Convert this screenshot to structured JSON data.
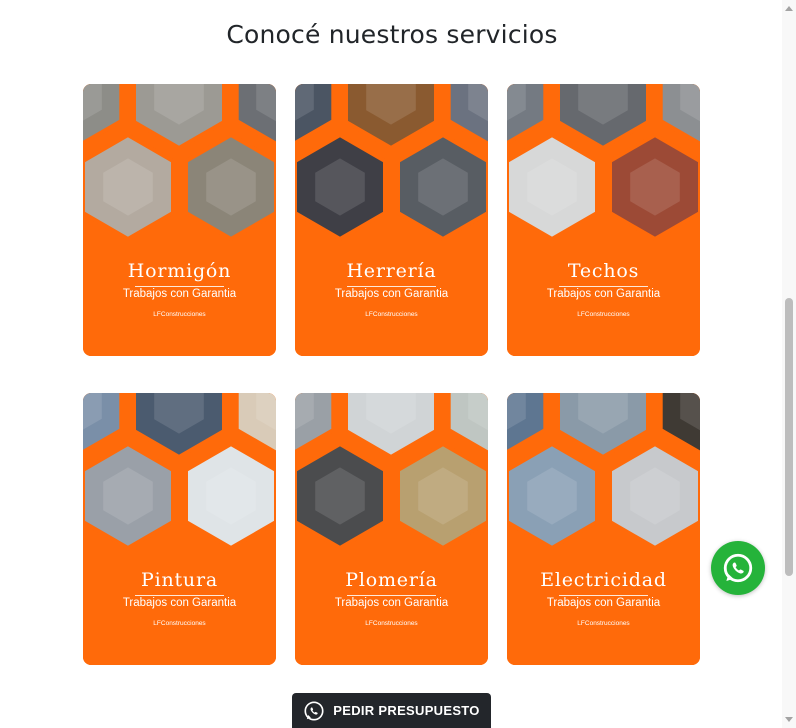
{
  "section": {
    "title": "Conocé nuestros servicios"
  },
  "services": [
    {
      "title": "Hormigón",
      "subtitle": "Trabajos con Garantia",
      "brand": "LFConstrucciones",
      "photos": [
        "#8d8d88",
        "#9c9a94",
        "#6c6f74",
        "#b3aaa0",
        "#8b8578"
      ]
    },
    {
      "title": "Herrería",
      "subtitle": "Trabajos con Garantia",
      "brand": "LFConstrucciones",
      "photos": [
        "#4b5563",
        "#8a5a30",
        "#6b7280",
        "#3f3f46",
        "#585d63"
      ]
    },
    {
      "title": "Techos",
      "subtitle": "Trabajos con Garantia",
      "brand": "LFConstrucciones",
      "photos": [
        "#747a82",
        "#66696e",
        "#8c8f92",
        "#d7d8d8",
        "#9c4a36"
      ]
    },
    {
      "title": "Pintura",
      "subtitle": "Trabajos con Garantia",
      "brand": "LFConstrucciones",
      "photos": [
        "#7a8fa8",
        "#4b5b6f",
        "#d9cbb8",
        "#9aa0a8",
        "#dfe4e7"
      ]
    },
    {
      "title": "Plomería",
      "subtitle": "Trabajos con Garantia",
      "brand": "LFConstrucciones",
      "photos": [
        "#9aa0a6",
        "#d0d4d6",
        "#bfc6c2",
        "#4b4c4e",
        "#b8a070"
      ]
    },
    {
      "title": "Electricidad",
      "subtitle": "Trabajos con Garantia",
      "brand": "LFConstrucciones",
      "photos": [
        "#5e7691",
        "#8a9aa8",
        "#3f3a34",
        "#8aa0b5",
        "#c7c9cc"
      ]
    }
  ],
  "cta": {
    "label": "PEDIR PRESUPUESTO",
    "icon": "whatsapp-icon"
  },
  "floating": {
    "icon": "whatsapp-icon"
  },
  "colors": {
    "orange": "#ff6a0a",
    "dark": "#23262b",
    "whatsapp": "#25b33a"
  }
}
